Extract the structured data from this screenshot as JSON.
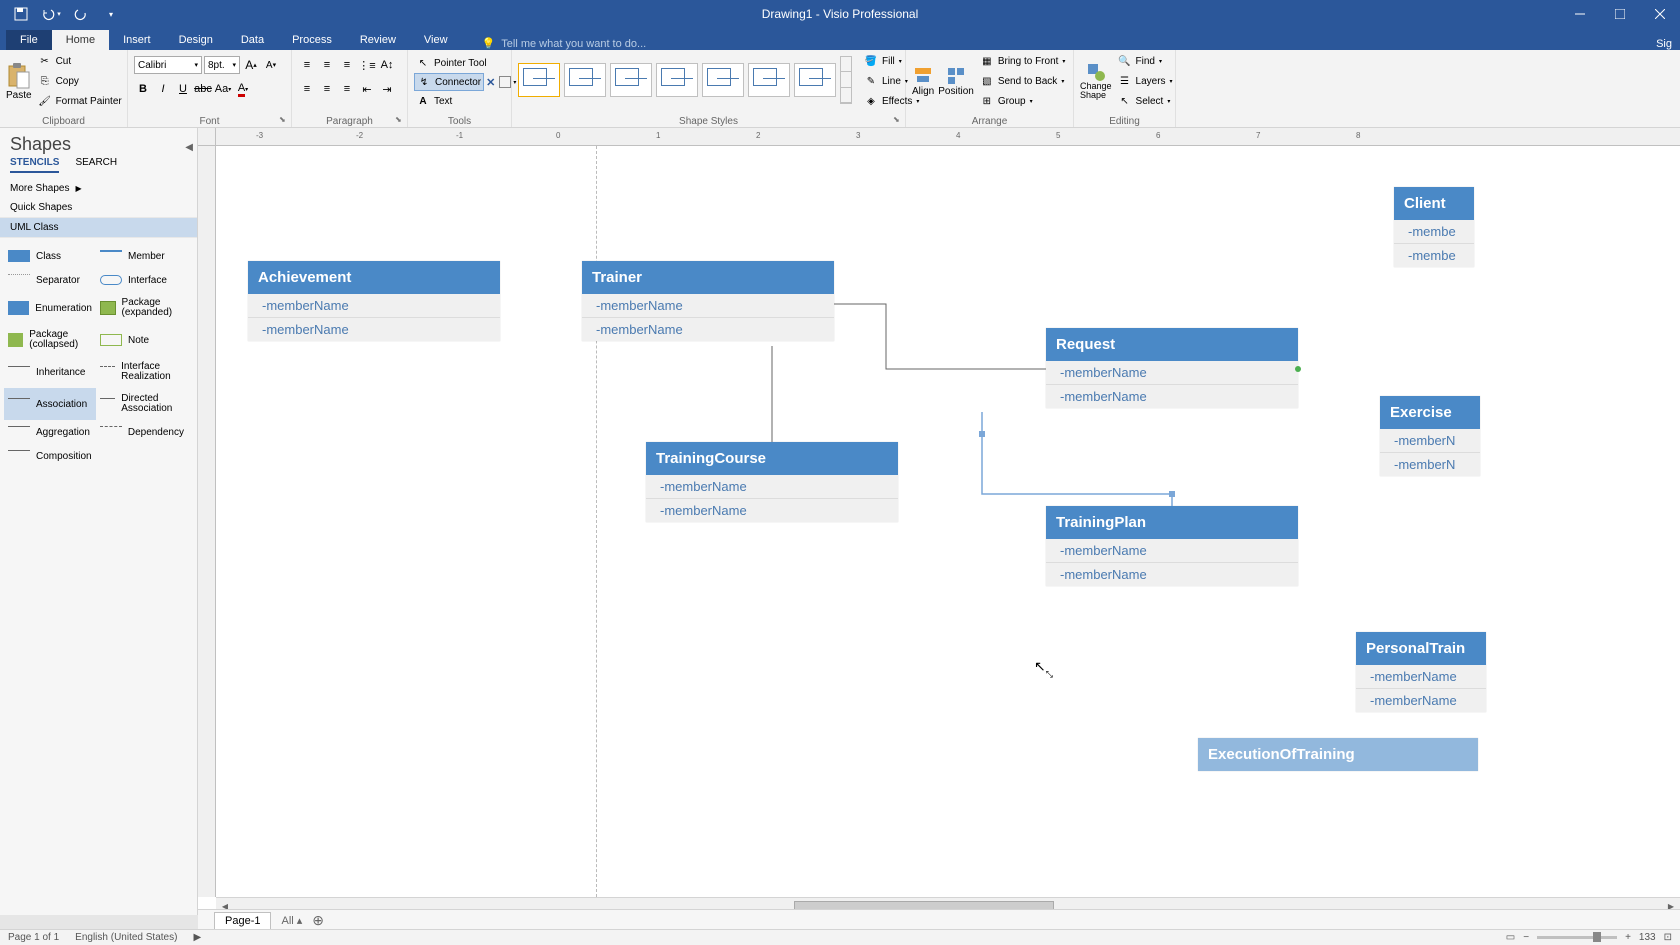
{
  "title": "Drawing1 - Visio Professional",
  "tabs": {
    "file": "File",
    "home": "Home",
    "insert": "Insert",
    "design": "Design",
    "data": "Data",
    "process": "Process",
    "review": "Review",
    "view": "View"
  },
  "tellme": "Tell me what you want to do...",
  "signin": "Sig",
  "ribbon": {
    "clipboard": {
      "label": "Clipboard",
      "paste": "Paste",
      "cut": "Cut",
      "copy": "Copy",
      "painter": "Format Painter"
    },
    "font": {
      "label": "Font",
      "name": "Calibri",
      "size": "8pt."
    },
    "paragraph": {
      "label": "Paragraph"
    },
    "tools": {
      "label": "Tools",
      "pointer": "Pointer Tool",
      "connector": "Connector",
      "text": "Text"
    },
    "styles": {
      "label": "Shape Styles",
      "fill": "Fill",
      "line": "Line",
      "effects": "Effects"
    },
    "arrange": {
      "label": "Arrange",
      "align": "Align",
      "position": "Position",
      "bringfront": "Bring to Front",
      "sendback": "Send to Back",
      "group": "Group"
    },
    "editing": {
      "label": "Editing",
      "changeshape": "Change Shape",
      "find": "Find",
      "layers": "Layers",
      "select": "Select"
    }
  },
  "shapes": {
    "title": "Shapes",
    "tabs": {
      "stencils": "STENCILS",
      "search": "SEARCH"
    },
    "more": "More Shapes",
    "quick": "Quick Shapes",
    "umlclass": "UML Class",
    "items": {
      "class": "Class",
      "member": "Member",
      "separator": "Separator",
      "interface": "Interface",
      "enumeration": "Enumeration",
      "pkgexp": "Package (expanded)",
      "pkgcol": "Package (collapsed)",
      "note": "Note",
      "inheritance": "Inheritance",
      "intfreal": "Interface Realization",
      "association": "Association",
      "dirassoc": "Directed Association",
      "aggregation": "Aggregation",
      "dependency": "Dependency",
      "composition": "Composition"
    }
  },
  "canvas": {
    "achievement": {
      "title": "Achievement",
      "m1": "-memberName",
      "m2": "-memberName"
    },
    "trainer": {
      "title": "Trainer",
      "m1": "-memberName",
      "m2": "-memberName"
    },
    "request": {
      "title": "Request",
      "m1": "-memberName",
      "m2": "-memberName"
    },
    "trainingcourse": {
      "title": "TrainingCourse",
      "m1": "-memberName",
      "m2": "-memberName"
    },
    "trainingplan": {
      "title": "TrainingPlan",
      "m1": "-memberName",
      "m2": "-memberName"
    },
    "client": {
      "title": "Client",
      "m1": "-membe",
      "m2": "-membe"
    },
    "exercise": {
      "title": "Exercise",
      "m1": "-memberN",
      "m2": "-memberN"
    },
    "personaltrain": {
      "title": "PersonalTrain",
      "m1": "-memberName",
      "m2": "-memberName"
    },
    "execution": {
      "title": "ExecutionOfTraining"
    }
  },
  "ruler": {
    "n3": "-3",
    "n2": "-2",
    "n1": "-1",
    "p0": "0",
    "p1": "1",
    "p2": "2",
    "p3": "3",
    "p4": "4",
    "p5": "5",
    "p6": "6",
    "p7": "7",
    "p8": "8"
  },
  "pagetabs": {
    "page1": "Page-1",
    "all": "All"
  },
  "status": {
    "page": "Page 1 of 1",
    "lang": "English (United States)",
    "zoom": "133"
  }
}
